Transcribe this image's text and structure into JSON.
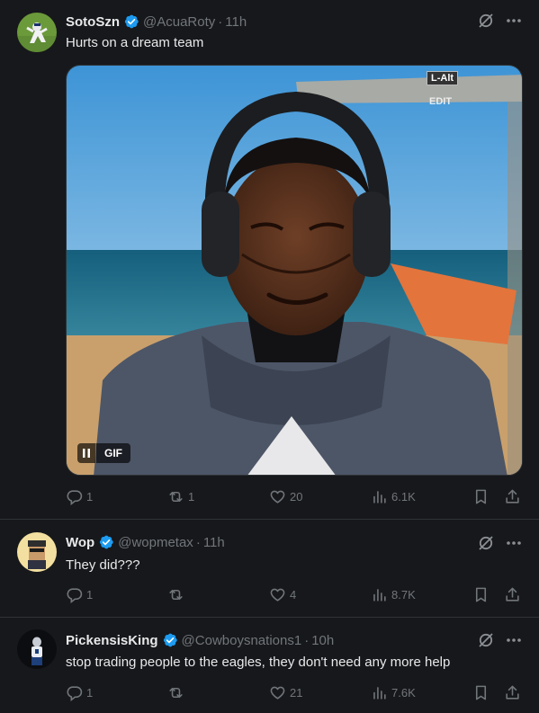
{
  "tweets": [
    {
      "name": "SotoSzn",
      "handle": "@AcuaRoty",
      "time": "11h",
      "text": "Hurts on a dream team",
      "media": {
        "badge": "GIF",
        "overlay_top": "L-Alt",
        "overlay_sub": "EDIT"
      },
      "replies": "1",
      "retweets": "1",
      "likes": "20",
      "views": "6.1K"
    },
    {
      "name": "Wop",
      "handle": "@wopmetax",
      "time": "11h",
      "text": "They did???",
      "replies": "1",
      "retweets": "",
      "likes": "4",
      "views": "8.7K"
    },
    {
      "name": "PickensisKing",
      "handle": "@Cowboysnations1",
      "time": "10h",
      "text": "stop trading people to the eagles, they don't need any more help",
      "replies": "1",
      "retweets": "",
      "likes": "21",
      "views": "7.6K"
    }
  ],
  "separator": "·",
  "colors": {
    "background": "#17181b",
    "verified": "#1d9bf0",
    "muted": "#71767b",
    "text": "#e7e9ea",
    "border": "#2f3336"
  },
  "icons": [
    "verified-badge-icon",
    "grok-icon",
    "more-icon",
    "reply-icon",
    "retweet-icon",
    "like-icon",
    "views-icon",
    "bookmark-icon",
    "share-icon",
    "pause-icon"
  ]
}
